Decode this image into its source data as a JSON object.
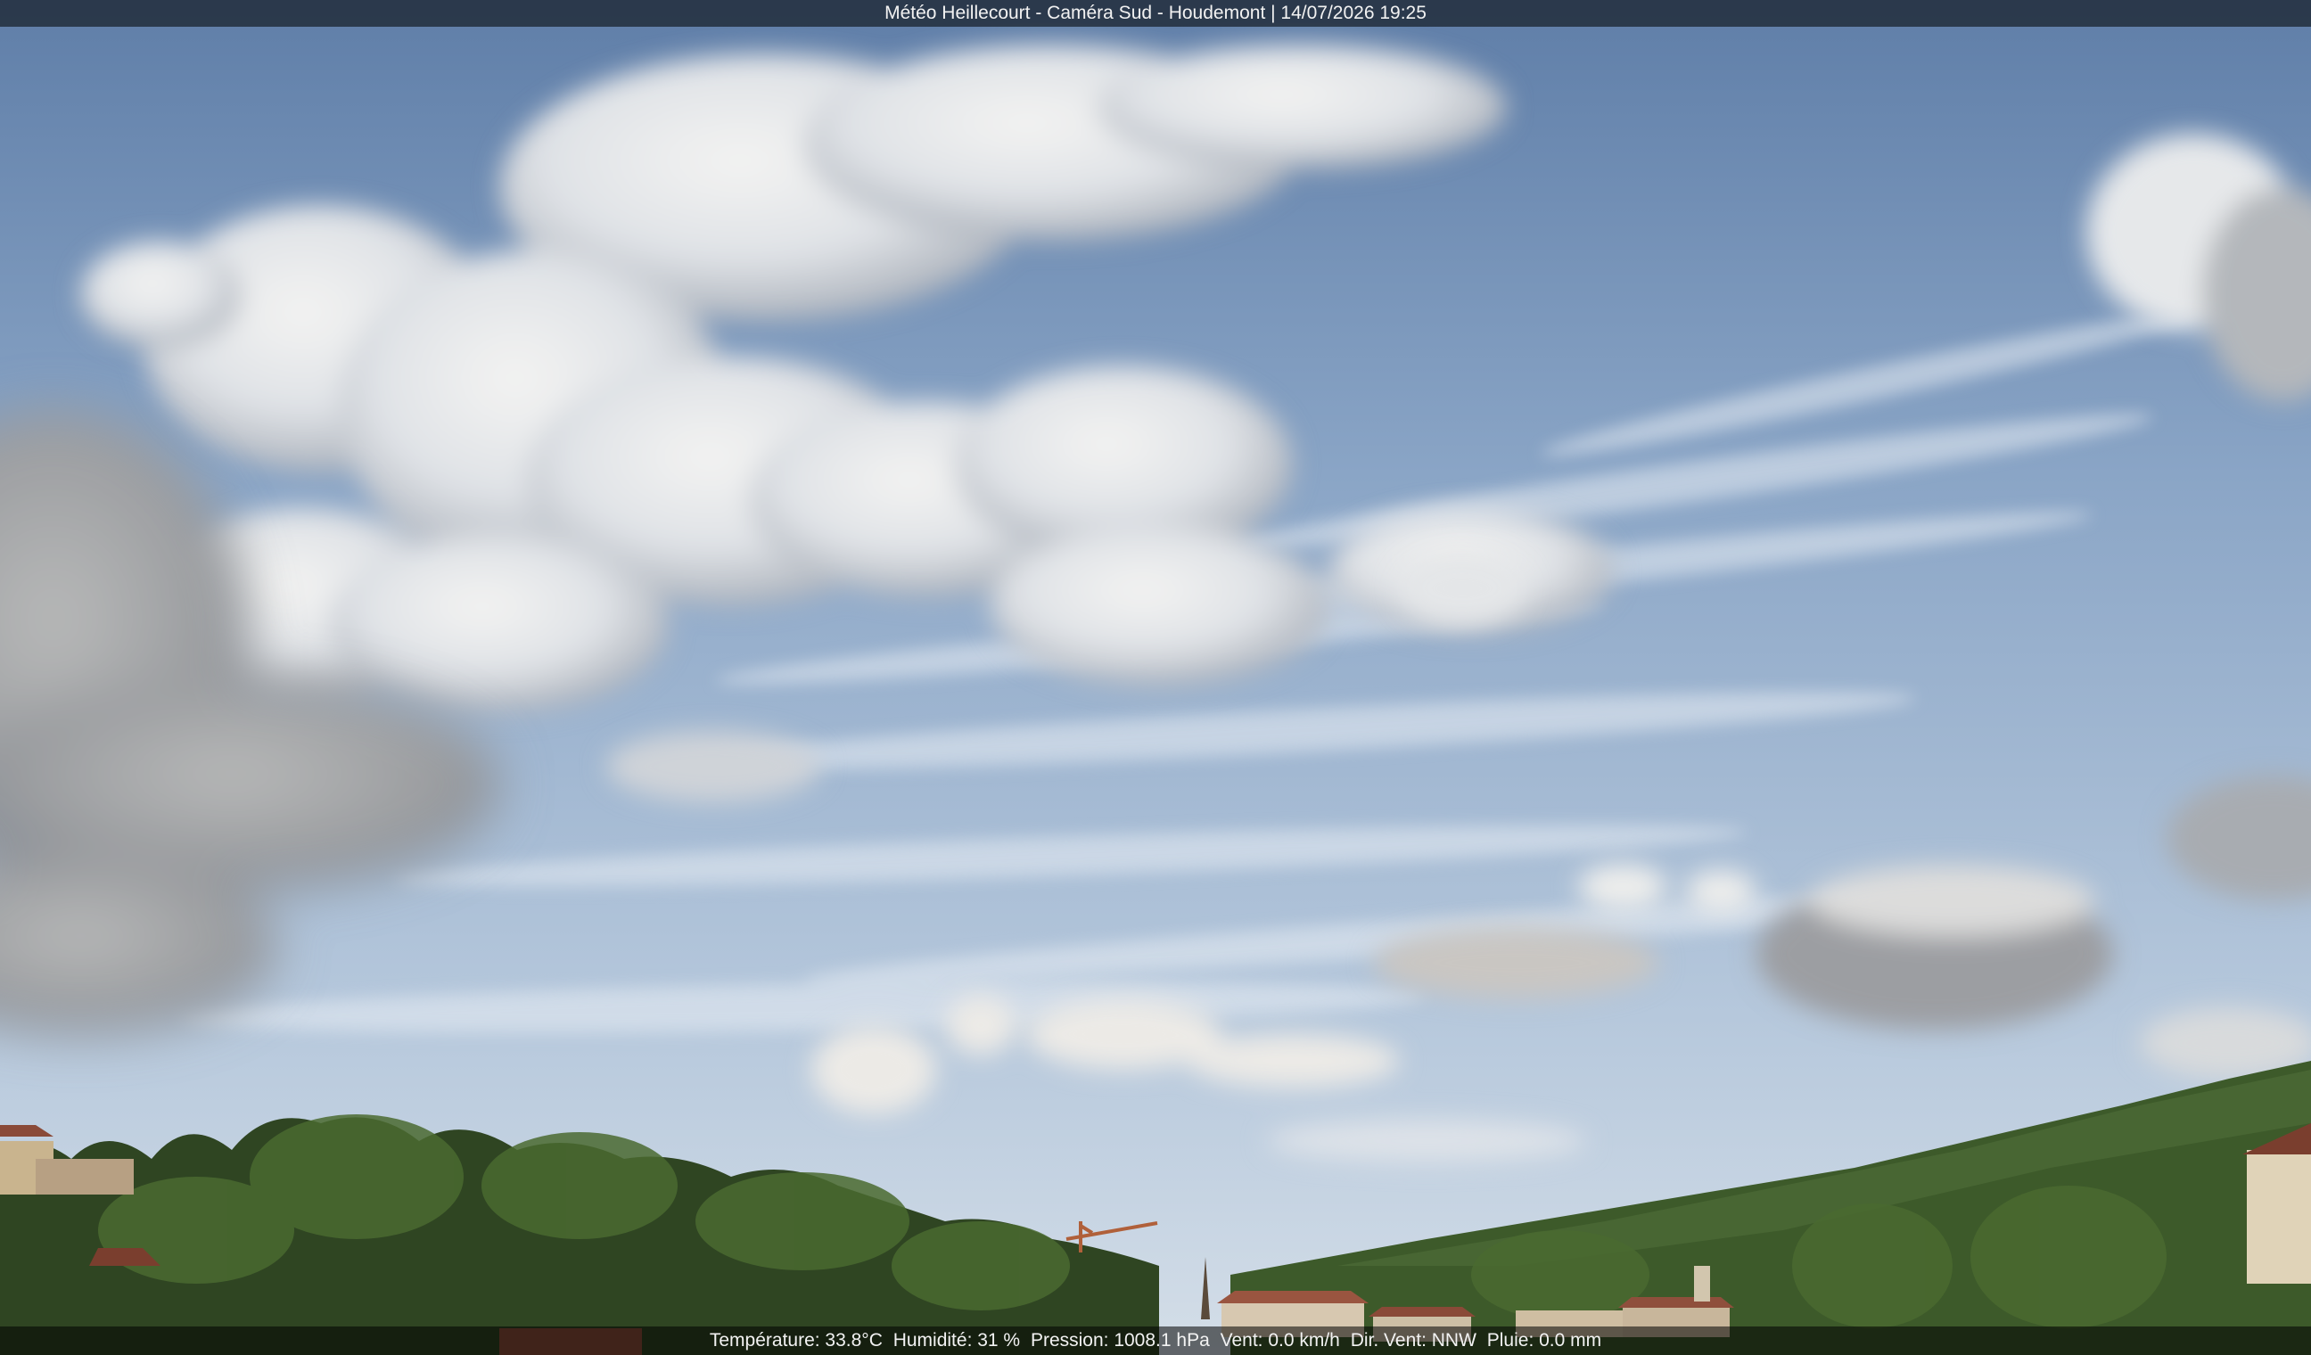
{
  "overlay_top": {
    "caption": "Météo Heillecourt - Caméra Sud - Houdemont | 14/07/2026 19:25"
  },
  "overlay_bottom": {
    "temperature": "Température: 33.8°C",
    "humidity": "Humidité: 31 %",
    "pressure": "Pression: 1008.1 hPa",
    "wind_speed": "Vent: 0.0 km/h",
    "wind_dir": "Dir. Vent: NNW",
    "rain": "Pluie: 0.0 mm"
  },
  "colors": {
    "sky_top": "#6f8db4",
    "sky_mid": "#9fb6d1",
    "sky_horizon": "#c9d6e3",
    "cloud_light": "#eef0f2",
    "cloud_shadow": "#9a9fa8",
    "tree_dark": "#2d4220",
    "tree_mid": "#4c6a32",
    "roof": "#8a4a38"
  }
}
